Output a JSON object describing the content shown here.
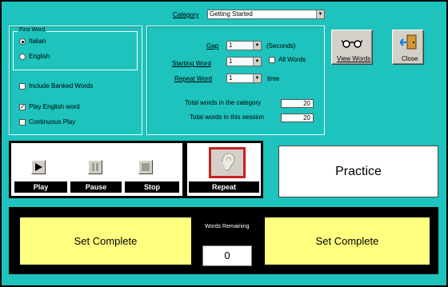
{
  "category": {
    "label": "Category",
    "value": "Getting Started",
    "dropdown_icon": "chevron-down-icon"
  },
  "first_word": {
    "legend": "First Word",
    "options": [
      {
        "label": "Italian",
        "selected": true
      },
      {
        "label": "English",
        "selected": false
      }
    ]
  },
  "checkboxes": {
    "include_banked": {
      "label": "Include Banked Words",
      "checked": false
    },
    "play_english": {
      "label": "Play English word",
      "checked": true
    },
    "continuous_play": {
      "label": "Continuous Play",
      "checked": false
    }
  },
  "settings": {
    "gap": {
      "label": "Gap",
      "value": "1",
      "unit": "(Seconds)"
    },
    "starting_word": {
      "label": "Starting Word",
      "value": "1"
    },
    "all_words": {
      "label": "All Words",
      "checked": false
    },
    "repeat_word": {
      "label": "Repeat Word",
      "value": "1",
      "unit": "time"
    },
    "total_category": {
      "label": "Total words in the category",
      "value": "20"
    },
    "total_session": {
      "label": "Total words in this session",
      "value": "20"
    }
  },
  "buttons": {
    "view_words": {
      "label": "View Words",
      "icon": "glasses-icon"
    },
    "close": {
      "label": "Close",
      "icon": "exit-door-icon"
    },
    "practice": {
      "label": "Practice"
    }
  },
  "media": {
    "play": {
      "label": "Play",
      "icon": "play-icon"
    },
    "pause": {
      "label": "Pause",
      "icon": "pause-icon"
    },
    "stop": {
      "label": "Stop",
      "icon": "stop-icon"
    },
    "repeat": {
      "label": "Repeat",
      "icon": "ear-icon"
    }
  },
  "bottom": {
    "left_status": "Set Complete",
    "right_status": "Set Complete",
    "words_remaining_label": "Words Remaining",
    "words_remaining_value": "0"
  },
  "colors": {
    "background": "#1dc3bc",
    "status_fill": "#ffff80",
    "repeat_border": "#cc1f1f"
  }
}
